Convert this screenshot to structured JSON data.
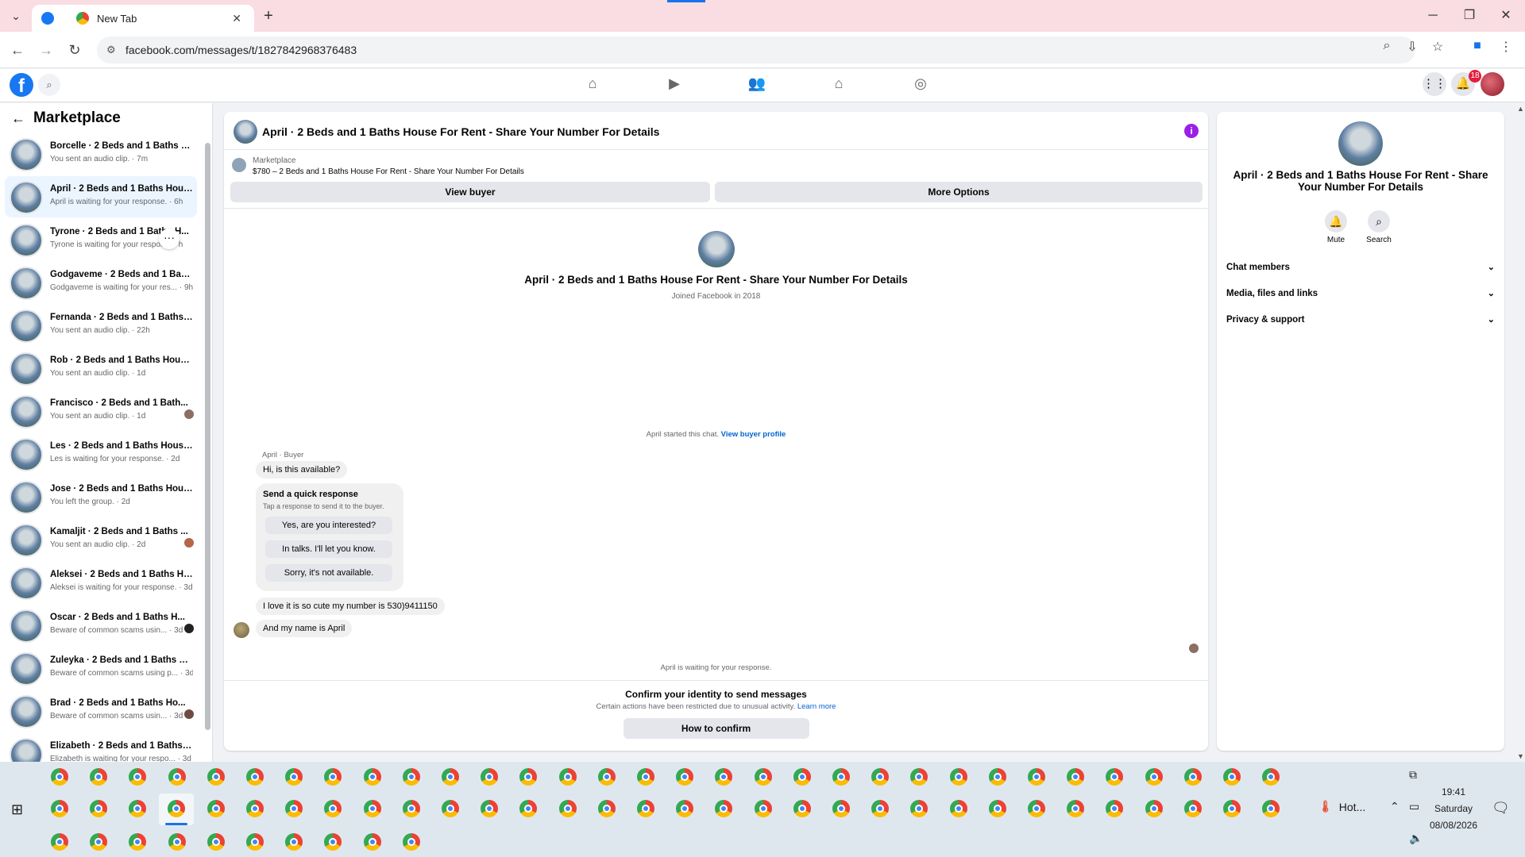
{
  "browser": {
    "active_tab_title": "",
    "inactive_tab_title": "New Tab",
    "url": "facebook.com/messages/t/1827842968376483",
    "accent_color": "#1a73e8",
    "tabbar_color": "#f9dde2"
  },
  "header": {
    "notification_count": "18",
    "brand_color": "#1877f2"
  },
  "sidebar": {
    "title": "Marketplace",
    "conversations": [
      {
        "name": "Borcelle · 2 Beds and 1 Baths H...",
        "sub": "You sent an audio clip. · 7m"
      },
      {
        "name": "April · 2 Beds and 1 Baths Hous...",
        "sub": "April is waiting for your response. · 6h"
      },
      {
        "name": "Tyrone · 2 Beds and 1 Baths H...",
        "sub": "Tyrone is waiting for your respon... · h"
      },
      {
        "name": "Godgaveme · 2 Beds and 1 Bath...",
        "sub": "Godgaveme is waiting for your res... · 9h"
      },
      {
        "name": "Fernanda · 2 Beds and 1 Baths ...",
        "sub": "You sent an audio clip. · 22h"
      },
      {
        "name": "Rob · 2 Beds and 1 Baths House...",
        "sub": "You sent an audio clip. · 1d"
      },
      {
        "name": "Francisco · 2 Beds and 1 Bath...",
        "sub": "You sent an audio clip. · 1d"
      },
      {
        "name": "Les · 2 Beds and 1 Baths House ...",
        "sub": "Les is waiting for your response. · 2d"
      },
      {
        "name": "Jose · 2 Beds and 1 Baths House...",
        "sub": "You left the group. · 2d"
      },
      {
        "name": "Kamaljit · 2 Beds and 1 Baths ...",
        "sub": "You sent an audio clip. · 2d"
      },
      {
        "name": "Aleksei · 2 Beds and 1 Baths Ho...",
        "sub": "Aleksei is waiting for your response. · 3d"
      },
      {
        "name": "Oscar · 2 Beds and 1 Baths H...",
        "sub": "Beware of common scams usin... · 3d"
      },
      {
        "name": "Zuleyka · 2 Beds and 1 Baths Ho...",
        "sub": "Beware of common scams using p... · 3d"
      },
      {
        "name": "Brad · 2 Beds and 1 Baths Ho...",
        "sub": "Beware of common scams usin... · 3d"
      },
      {
        "name": "Elizabeth · 2 Beds and 1 Baths H...",
        "sub": "Elizabeth is waiting for your respo... · 3d"
      }
    ]
  },
  "chat": {
    "title": "April · 2 Beds and 1 Baths House For Rent - Share Your Number For Details",
    "listing_source": "Marketplace",
    "listing_title": "$780 – 2 Beds and 1 Baths House For Rent - Share Your Number For Details",
    "view_buyer_label": "View buyer",
    "more_options_label": "More Options",
    "profile_name": "April · 2 Beds and 1 Baths House For Rent - Share Your Number For Details",
    "joined": "Joined Facebook in 2018",
    "started_text": "April started this chat.",
    "view_buyer_profile": "View buyer profile",
    "sender_label": "April · Buyer",
    "msg1": "Hi, is this available?",
    "quick_title": "Send a quick response",
    "quick_sub": "Tap a response to send it to the buyer.",
    "quick_options": [
      "Yes, are you interested?",
      "In talks. I'll let you know.",
      "Sorry, it's not available."
    ],
    "msg2": "I love it is so cute my number is 530)9411150",
    "msg3": "And my name is April",
    "waiting": "April is waiting for your response.",
    "confirm_title": "Confirm your identity to send messages",
    "confirm_sub": "Certain actions have been restricted due to unusual activity.",
    "learn_more": "Learn more",
    "how_to_confirm": "How to confirm"
  },
  "details": {
    "title": "April · 2 Beds and 1 Baths House For Rent - Share Your Number For Details",
    "mute_label": "Mute",
    "search_label": "Search",
    "sections": [
      "Chat members",
      "Media, files and links",
      "Privacy & support"
    ]
  },
  "taskbar": {
    "weather": "Hot...",
    "time": "19:41",
    "day": "Saturday",
    "date": "08/08/2026"
  }
}
